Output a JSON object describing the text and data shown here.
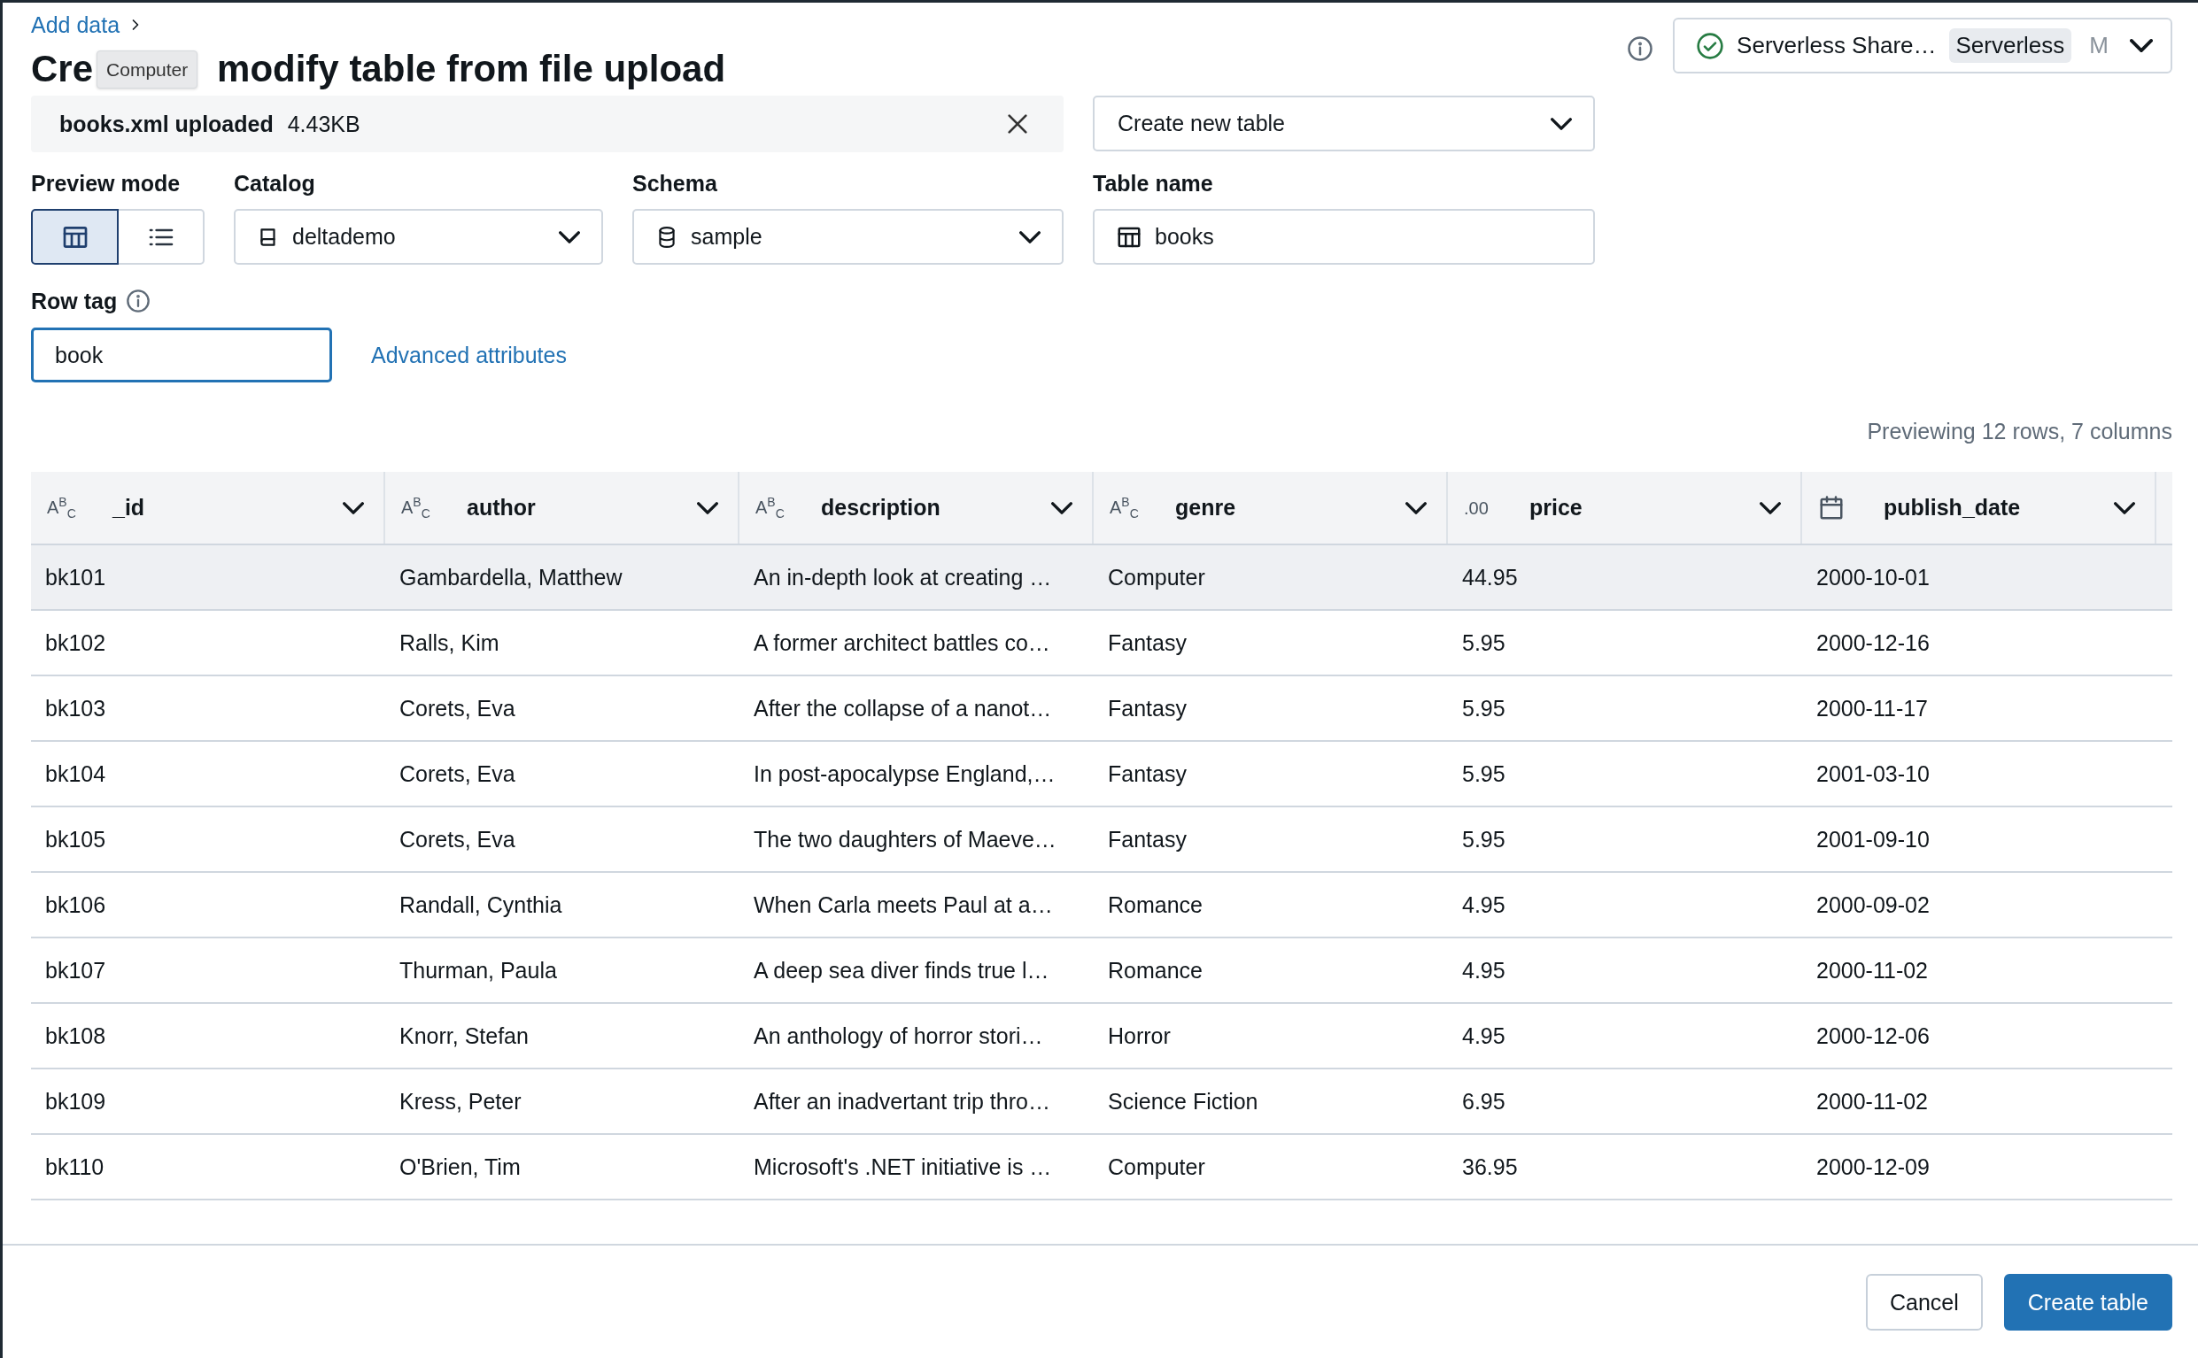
{
  "breadcrumb": {
    "link": "Add data"
  },
  "title": {
    "start": "Cre",
    "end": "modify table from file upload"
  },
  "tooltip": {
    "text": "Computer"
  },
  "compute": {
    "name": "Serverless Share…",
    "badge": "Serverless",
    "initial": "M"
  },
  "upload": {
    "filename": "books.xml uploaded",
    "size": "4.43KB"
  },
  "table_action": {
    "value": "Create new table"
  },
  "preview_mode": {
    "label": "Preview mode",
    "options": [
      {
        "kind": "table",
        "selected": true
      },
      {
        "kind": "list",
        "selected": false
      }
    ]
  },
  "catalog": {
    "label": "Catalog",
    "value": "deltademo"
  },
  "schema": {
    "label": "Schema",
    "value": "sample"
  },
  "table_name": {
    "label": "Table name",
    "value": "books"
  },
  "row_tag": {
    "label": "Row tag",
    "value": "book",
    "focused": true
  },
  "advanced_link": "Advanced attributes",
  "preview_summary": "Previewing 12 rows, 7 columns",
  "table": {
    "columns": [
      {
        "name": "_id",
        "kind": "text",
        "type_label": "A$^{B}$$_{C}$"
      },
      {
        "name": "author",
        "kind": "text",
        "type_label": "A$^{B}$$_{C}$"
      },
      {
        "name": "description",
        "kind": "text",
        "type_label": "A$^{B}$$_{C}$"
      },
      {
        "name": "genre",
        "kind": "text",
        "type_label": "A$^{B}$$_{C}$"
      },
      {
        "name": "price",
        "kind": "text",
        "type_label": ".00"
      },
      {
        "name": "publish_date",
        "kind": "date"
      }
    ],
    "rows": [
      {
        "highlighted": true,
        "cells": [
          "bk101",
          "Gambardella, Matthew",
          "An in-depth look at creating …",
          "Computer",
          "44.95",
          "2000-10-01"
        ]
      },
      {
        "highlighted": false,
        "cells": [
          "bk102",
          "Ralls, Kim",
          "A former architect battles co…",
          "Fantasy",
          "5.95",
          "2000-12-16"
        ]
      },
      {
        "highlighted": false,
        "cells": [
          "bk103",
          "Corets, Eva",
          "After the collapse of a nanot…",
          "Fantasy",
          "5.95",
          "2000-11-17"
        ]
      },
      {
        "highlighted": false,
        "cells": [
          "bk104",
          "Corets, Eva",
          "In post-apocalypse England,…",
          "Fantasy",
          "5.95",
          "2001-03-10"
        ]
      },
      {
        "highlighted": false,
        "cells": [
          "bk105",
          "Corets, Eva",
          "The two daughters of Maeve…",
          "Fantasy",
          "5.95",
          "2001-09-10"
        ]
      },
      {
        "highlighted": false,
        "cells": [
          "bk106",
          "Randall, Cynthia",
          "When Carla meets Paul at a…",
          "Romance",
          "4.95",
          "2000-09-02"
        ]
      },
      {
        "highlighted": false,
        "cells": [
          "bk107",
          "Thurman, Paula",
          "A deep sea diver finds true l…",
          "Romance",
          "4.95",
          "2000-11-02"
        ]
      },
      {
        "highlighted": false,
        "cells": [
          "bk108",
          "Knorr, Stefan",
          "An anthology of horror stori…",
          "Horror",
          "4.95",
          "2000-12-06"
        ]
      },
      {
        "highlighted": false,
        "cells": [
          "bk109",
          "Kress, Peter",
          "After an inadvertant trip thro…",
          "Science Fiction",
          "6.95",
          "2000-11-02"
        ]
      },
      {
        "highlighted": false,
        "cells": [
          "bk110",
          "O'Brien, Tim",
          "Microsoft's .NET initiative is …",
          "Computer",
          "36.95",
          "2000-12-09"
        ]
      }
    ]
  },
  "buttons": [
    {
      "label": "Cancel",
      "kind": "secondary"
    },
    {
      "label": "Create table",
      "kind": "primary"
    }
  ]
}
